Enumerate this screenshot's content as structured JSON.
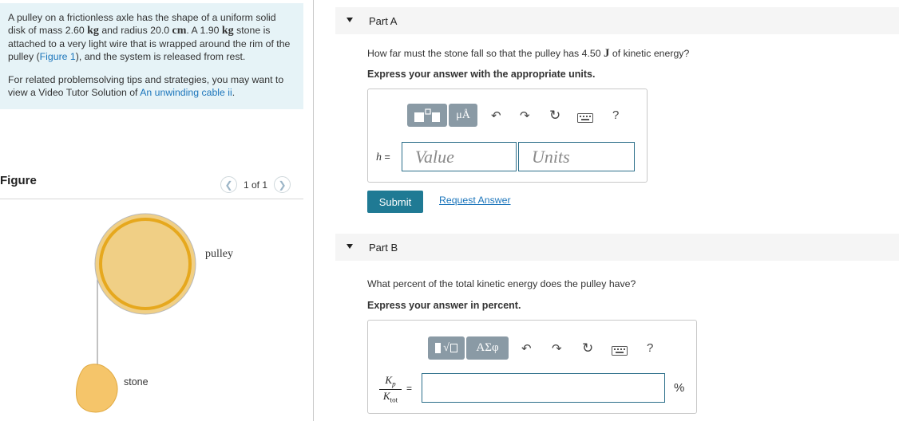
{
  "problem": {
    "p1_a": "A pulley on a frictionless axle has the shape of a uniform solid disk of mass 2.60 ",
    "p1_unit1": "kg",
    "p1_b": " and radius 20.0 ",
    "p1_unit2": "cm",
    "p1_c": ". A 1.90 ",
    "p1_unit3": "kg",
    "p1_d": " stone is attached to a very light wire that is wrapped around the rim of the pulley (",
    "p1_figure_link": "Figure 1",
    "p1_e": "), and the system is released from rest.",
    "p2_a": "For related problemsolving tips and strategies, you may want to view a Video Tutor Solution of ",
    "p2_link": "An unwinding cable ii",
    "p2_b": "."
  },
  "figure": {
    "title": "Figure",
    "pager_text": "1 of 1",
    "prev_icon": "chevron-left-icon",
    "next_icon": "chevron-right-icon",
    "pulley_label": "pulley",
    "stone_label": "stone"
  },
  "part_a": {
    "title": "Part A",
    "question_a": "How far must the stone fall so that the pulley has 4.50 ",
    "question_unit": "J",
    "question_b": " of kinetic energy?",
    "instruction": "Express your answer with the appropriate units.",
    "toolbar": {
      "mu_a_label": "μÅ",
      "help_label": "?"
    },
    "var_label": "h =",
    "value_placeholder": "Value",
    "units_placeholder": "Units",
    "submit_label": "Submit",
    "request_label": "Request Answer"
  },
  "part_b": {
    "title": "Part B",
    "question": "What percent of the total kinetic energy does the pulley have?",
    "instruction": "Express your answer in percent.",
    "toolbar": {
      "sqrt_label": "√",
      "greek_label": "ΑΣφ",
      "help_label": "?"
    },
    "frac_num_main": "K",
    "frac_num_sub": "p",
    "frac_den_main": "K",
    "frac_den_sub": "tot",
    "equals": "=",
    "unit_suffix": "%"
  },
  "colors": {
    "accent": "#1f7a94",
    "link": "#1b75bb",
    "problem_bg": "#e6f3f7",
    "toolbar_btn": "#8a9aa5",
    "pulley_fill": "#f0cf85",
    "pulley_rim": "#e6a81e",
    "stone_fill": "#f5c56a"
  }
}
